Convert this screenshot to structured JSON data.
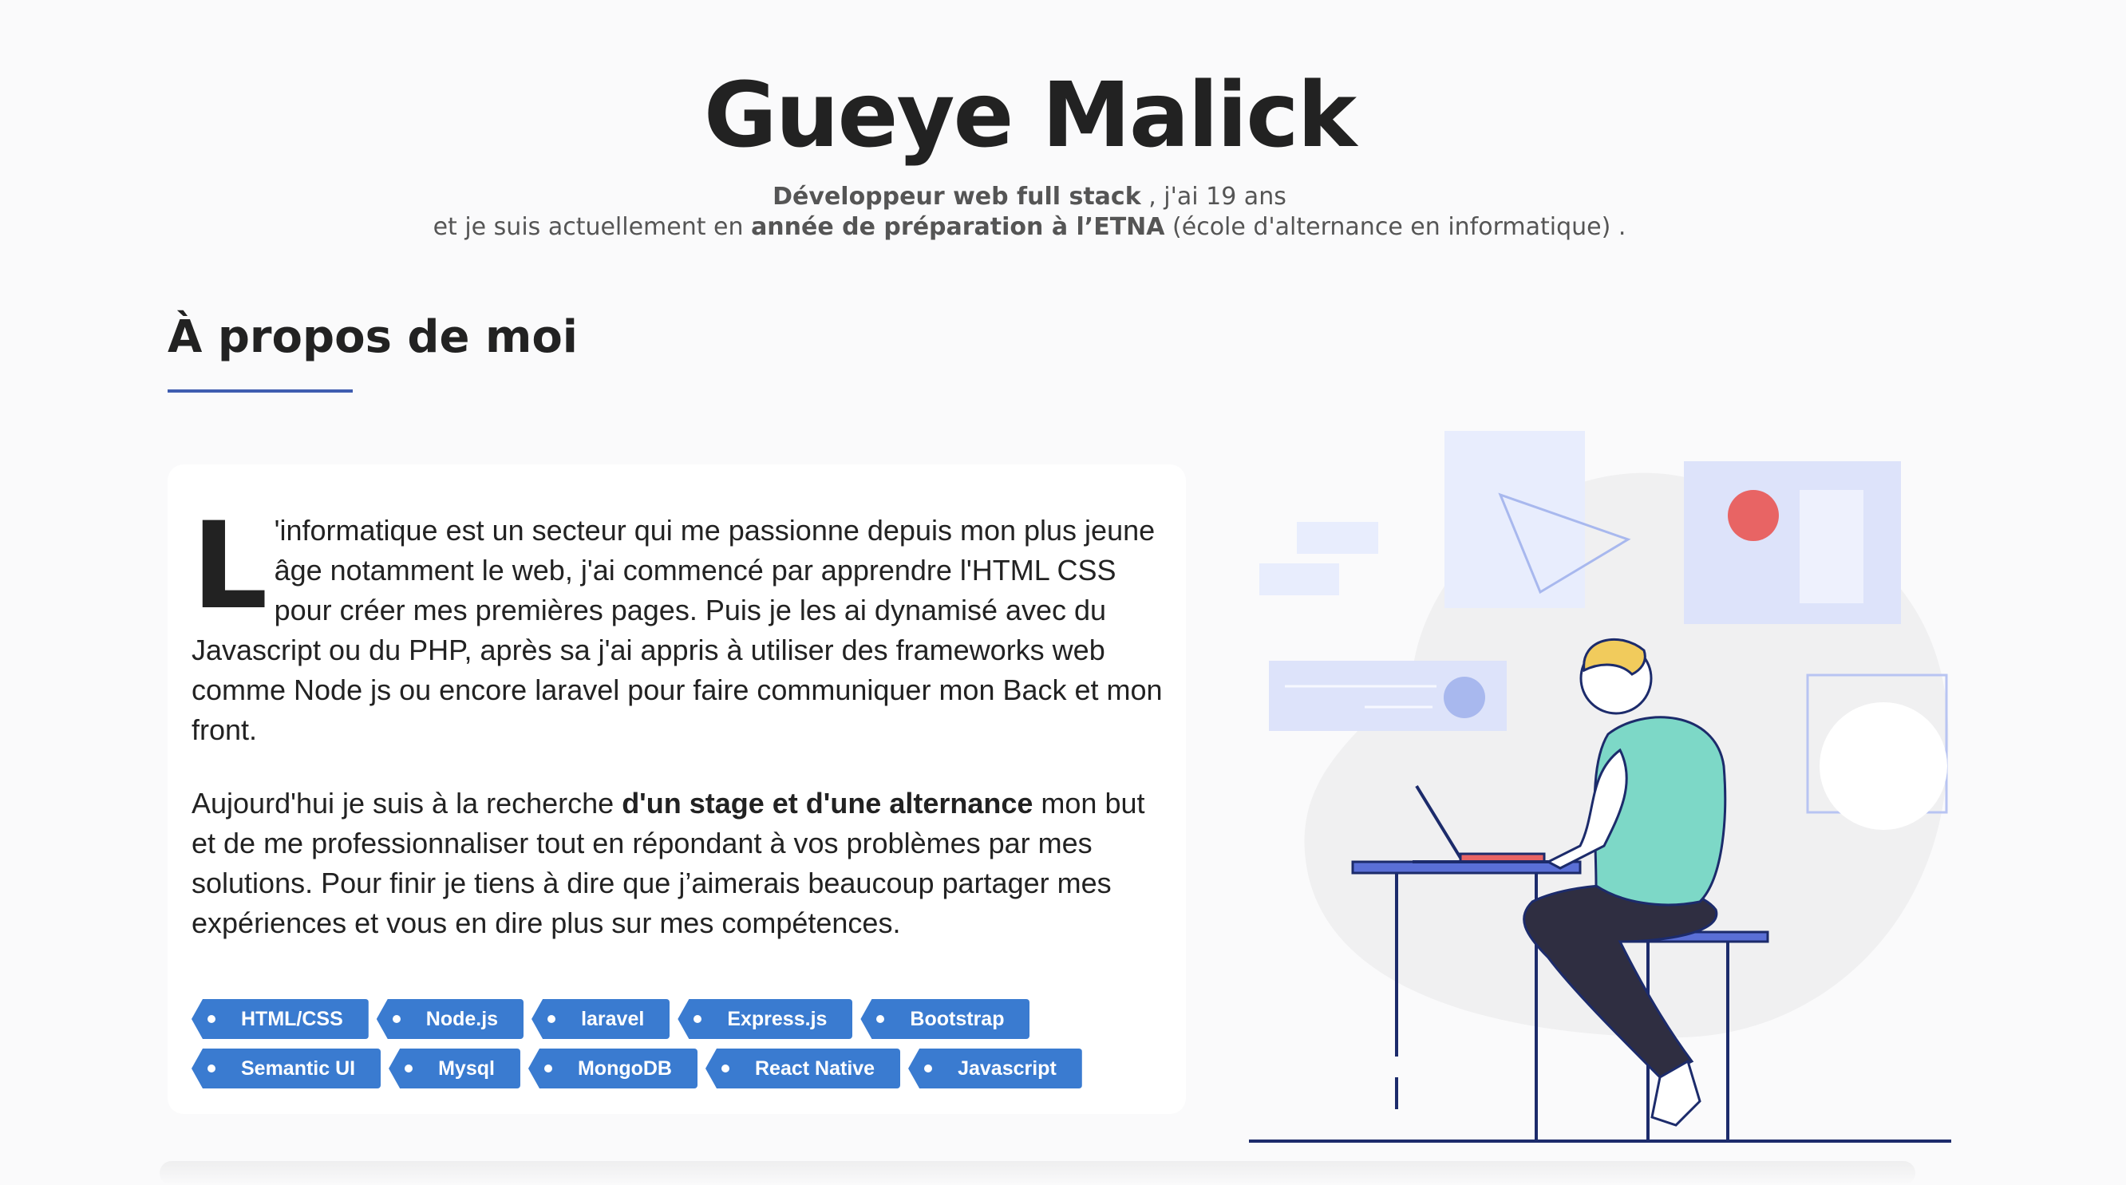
{
  "hero": {
    "name": "Gueye Malick",
    "line1_bold": "Développeur web full stack",
    "line1_rest": " , j'ai 19 ans",
    "line2_start": "et je suis actuellement en ",
    "line2_bold": "année de préparation à l’ETNA",
    "line2_rest": " (école d'alternance en informatique) ."
  },
  "about": {
    "title": "À propos de moi",
    "dropcap": "L",
    "paragraph1": "'informatique est un secteur qui me passionne depuis mon plus jeune âge notamment le web, j'ai commencé par apprendre l'HTML CSS pour créer mes premières pages. Puis je les ai dynamisé avec du Javascript ou du PHP, après sa j'ai appris à utiliser des frameworks web comme Node js ou encore laravel pour faire communiquer mon Back et mon front.",
    "paragraph2_start": "Aujourd'hui je suis à la recherche ",
    "paragraph2_bold": "d'un stage et d'une alternance",
    "paragraph2_rest": " mon but et de me professionnaliser tout en répondant à vos problèmes par mes solutions. Pour finir je tiens à dire que j’aimerais beaucoup partager mes expériences et vous en dire plus sur mes compétences."
  },
  "tags": {
    "row1": [
      "HTML/CSS",
      "Node.js",
      "laravel",
      "Express.js",
      "Bootstrap"
    ],
    "row2": [
      "Semantic UI",
      "Mysql",
      "MongoDB",
      "React Native",
      "Javascript"
    ]
  },
  "colors": {
    "accent": "#3f5db0",
    "tag_bg": "#3a7bd0",
    "illustration_shirt": "#7dd8c7",
    "illustration_hair": "#f1cb5c",
    "illustration_dot": "#e86464"
  }
}
